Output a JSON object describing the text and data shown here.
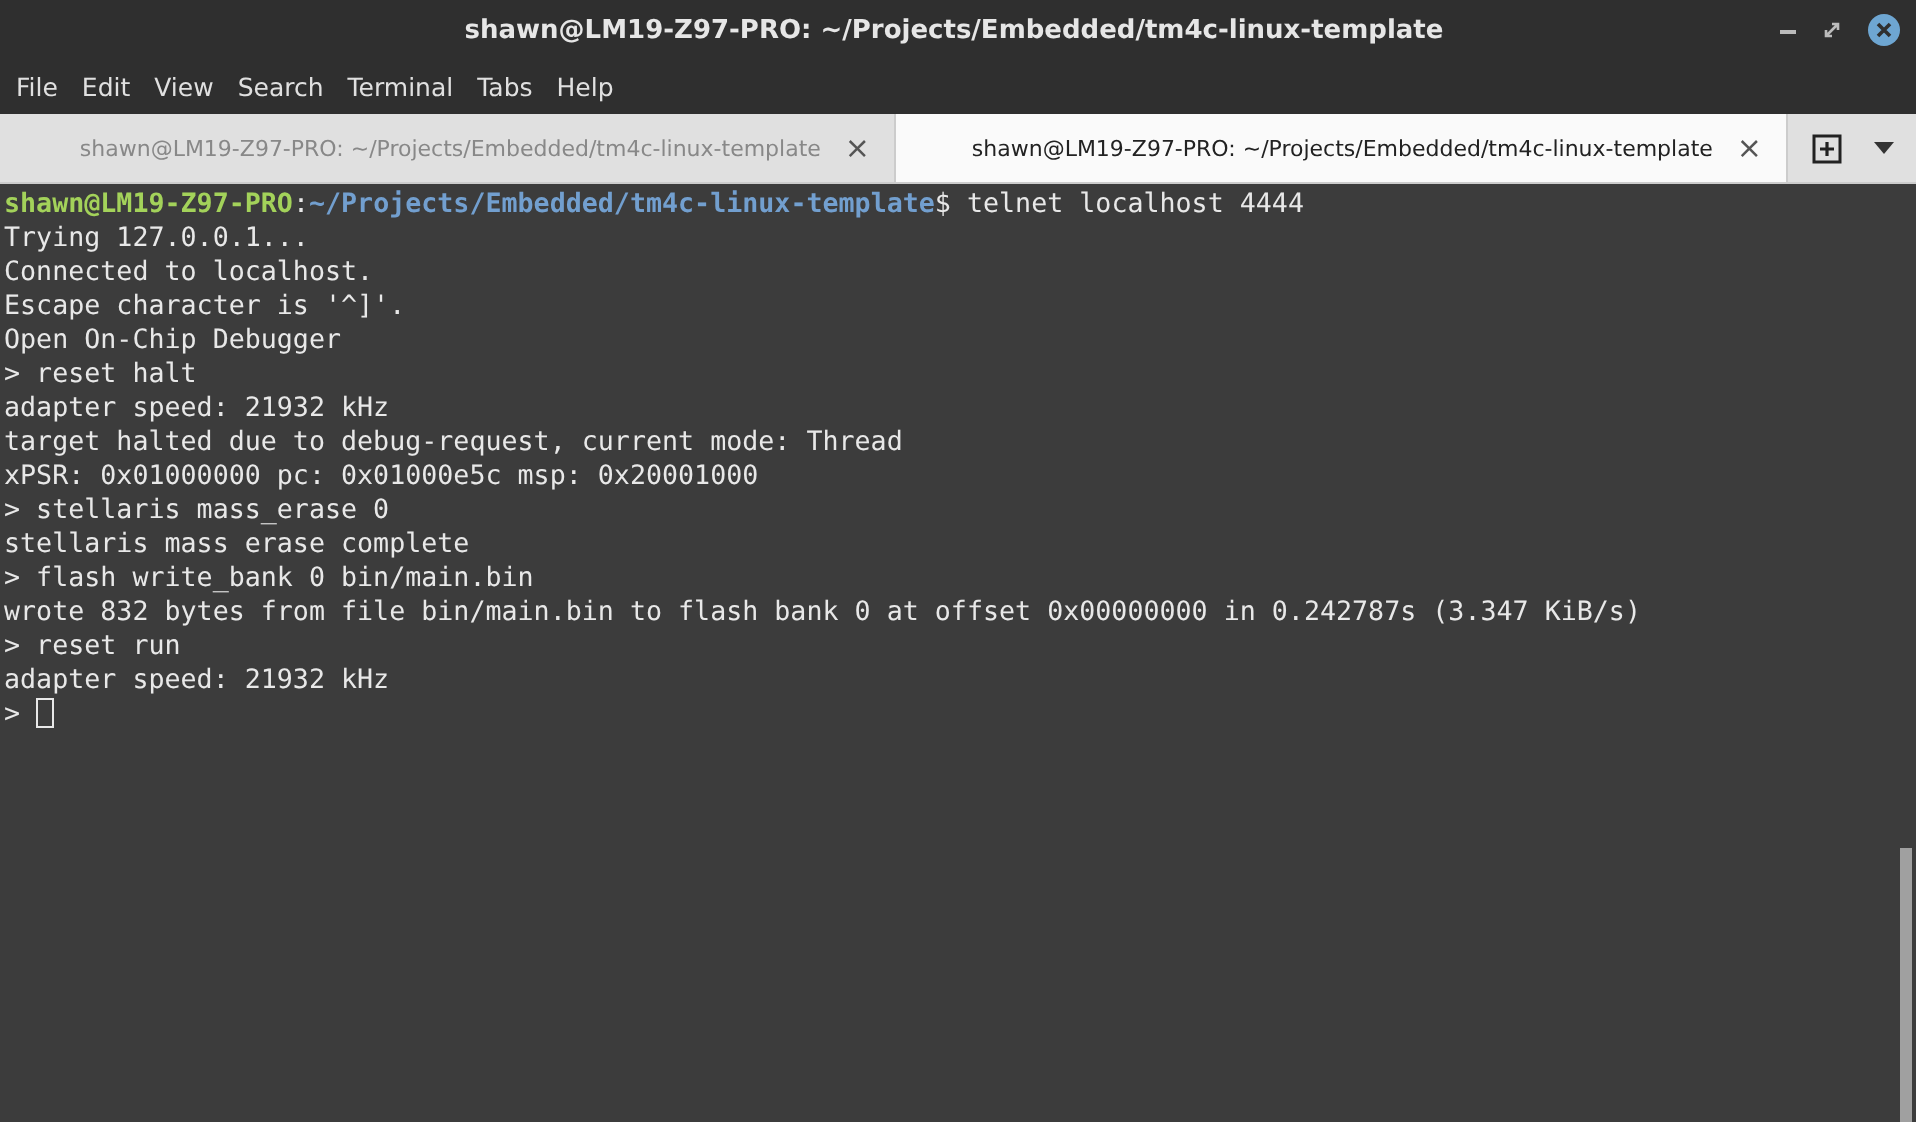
{
  "window": {
    "title": "shawn@LM19-Z97-PRO: ~/Projects/Embedded/tm4c-linux-template"
  },
  "menu": [
    "File",
    "Edit",
    "View",
    "Search",
    "Terminal",
    "Tabs",
    "Help"
  ],
  "tabs": [
    {
      "label": "shawn@LM19-Z97-PRO: ~/Projects/Embedded/tm4c-linux-template",
      "close": "×",
      "selected": false
    },
    {
      "label": "shawn@LM19-Z97-PRO: ~/Projects/Embedded/tm4c-linux-template",
      "close": "×",
      "selected": true
    }
  ],
  "terminal": {
    "prompt": {
      "user_host": "shawn@LM19-Z97-PRO",
      "separator": ":",
      "path": "~/Projects/Embedded/tm4c-linux-template",
      "command": "$ telnet localhost 4444"
    },
    "lines": [
      "Trying 127.0.0.1...",
      "Connected to localhost.",
      "Escape character is '^]'.",
      "Open On-Chip Debugger",
      "> reset halt",
      "adapter speed: 21932 kHz",
      "target halted due to debug-request, current mode: Thread",
      "xPSR: 0x01000000 pc: 0x01000e5c msp: 0x20001000",
      "> stellaris mass_erase 0",
      "stellaris mass erase complete",
      "> flash write_bank 0 bin/main.bin",
      "wrote 832 bytes from file bin/main.bin to flash bank 0 at offset 0x00000000 in 0.242787s (3.347 KiB/s)",
      "> reset run",
      "adapter speed: 21932 kHz"
    ],
    "input_prompt": ">"
  }
}
